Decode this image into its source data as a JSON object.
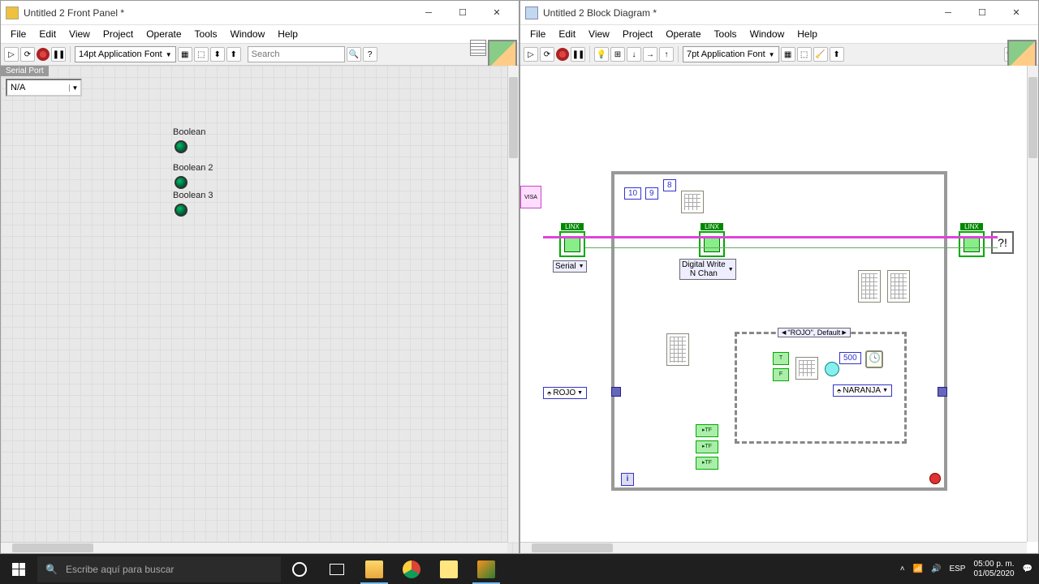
{
  "fp": {
    "title": "Untitled 2 Front Panel *",
    "menus": [
      "File",
      "Edit",
      "View",
      "Project",
      "Operate",
      "Tools",
      "Window",
      "Help"
    ],
    "font": "14pt Application Font",
    "search_placeholder": "Search",
    "serial_label": "Serial Port",
    "serial_value": "N/A",
    "leds": [
      {
        "label": "Boolean"
      },
      {
        "label": "Boolean 2"
      },
      {
        "label": "Boolean 3"
      }
    ]
  },
  "bd": {
    "title": "Untitled 2 Block Diagram *",
    "menus": [
      "File",
      "Edit",
      "View",
      "Project",
      "Operate",
      "Tools",
      "Window",
      "Help"
    ],
    "font": "7pt Application Font",
    "visa_label": "VISA",
    "linx_open_selector": "Serial",
    "digital_write_label": "Digital Write\nN Chan",
    "const10": "10",
    "const9": "9",
    "const8": "8",
    "case_selector": "\"ROJO\", Default",
    "enum_rojo": "ROJO",
    "enum_naranja": "NARANJA",
    "wait_ms": "500",
    "loop_i": "i"
  },
  "taskbar": {
    "search_placeholder": "Escribe aquí para buscar",
    "lang": "ESP",
    "time": "05:00 p. m.",
    "date": "01/05/2020"
  }
}
